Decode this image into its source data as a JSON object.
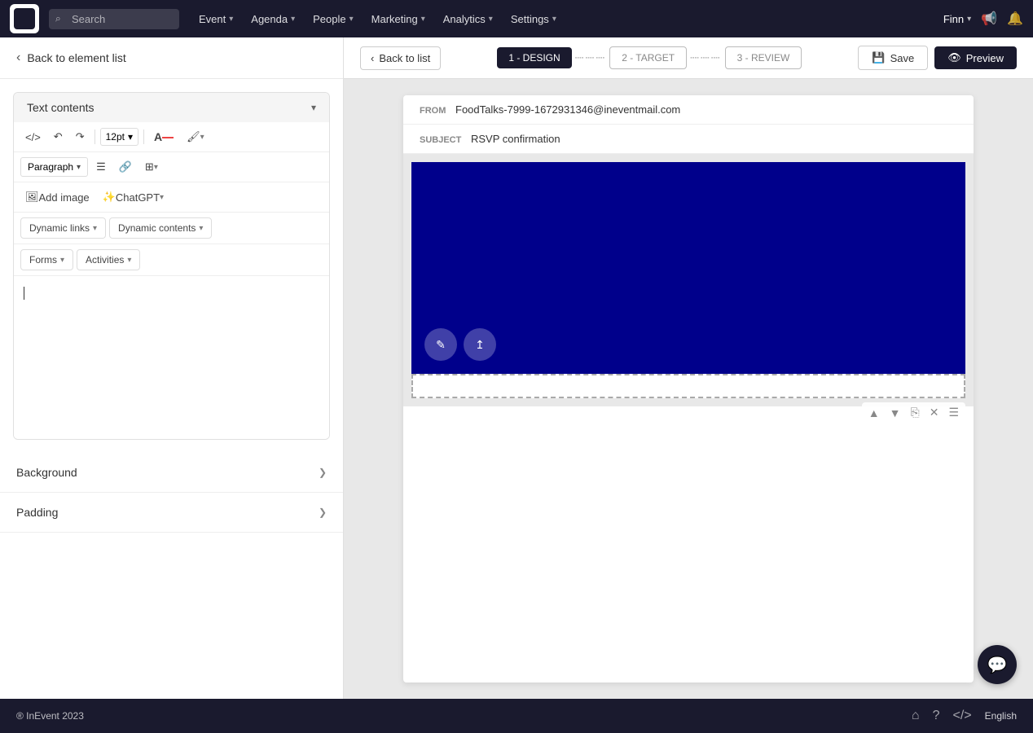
{
  "app": {
    "logo_alt": "InEvent"
  },
  "topnav": {
    "search_placeholder": "Search",
    "items": [
      {
        "label": "Event",
        "has_dropdown": true
      },
      {
        "label": "Agenda",
        "has_dropdown": true
      },
      {
        "label": "People",
        "has_dropdown": true
      },
      {
        "label": "Marketing",
        "has_dropdown": true
      },
      {
        "label": "Analytics",
        "has_dropdown": true
      },
      {
        "label": "Settings",
        "has_dropdown": true
      }
    ],
    "user_label": "Finn",
    "user_has_dropdown": true
  },
  "sidebar": {
    "back_label": "Back to element list",
    "text_contents_label": "Text contents",
    "font_size": "12pt",
    "paragraph_label": "Paragraph",
    "add_image_label": "Add image",
    "chatgpt_label": "ChatGPT",
    "dynamic_links_label": "Dynamic links",
    "dynamic_contents_label": "Dynamic contents",
    "forms_label": "Forms",
    "activities_label": "Activities",
    "background_label": "Background",
    "padding_label": "Padding"
  },
  "email": {
    "from_label": "FROM",
    "from_value": "FoodTalks-7999-1672931346@ineventmail.com",
    "subject_label": "SUBJECT",
    "subject_value": "RSVP confirmation"
  },
  "steps": {
    "step1": "1 - DESIGN",
    "step2": "2 - TARGET",
    "step3": "3 - REVIEW"
  },
  "actions": {
    "back_to_list": "Back to list",
    "save": "Save",
    "preview": "Preview"
  },
  "footer": {
    "copyright": "® InEvent 2023",
    "language": "English"
  }
}
